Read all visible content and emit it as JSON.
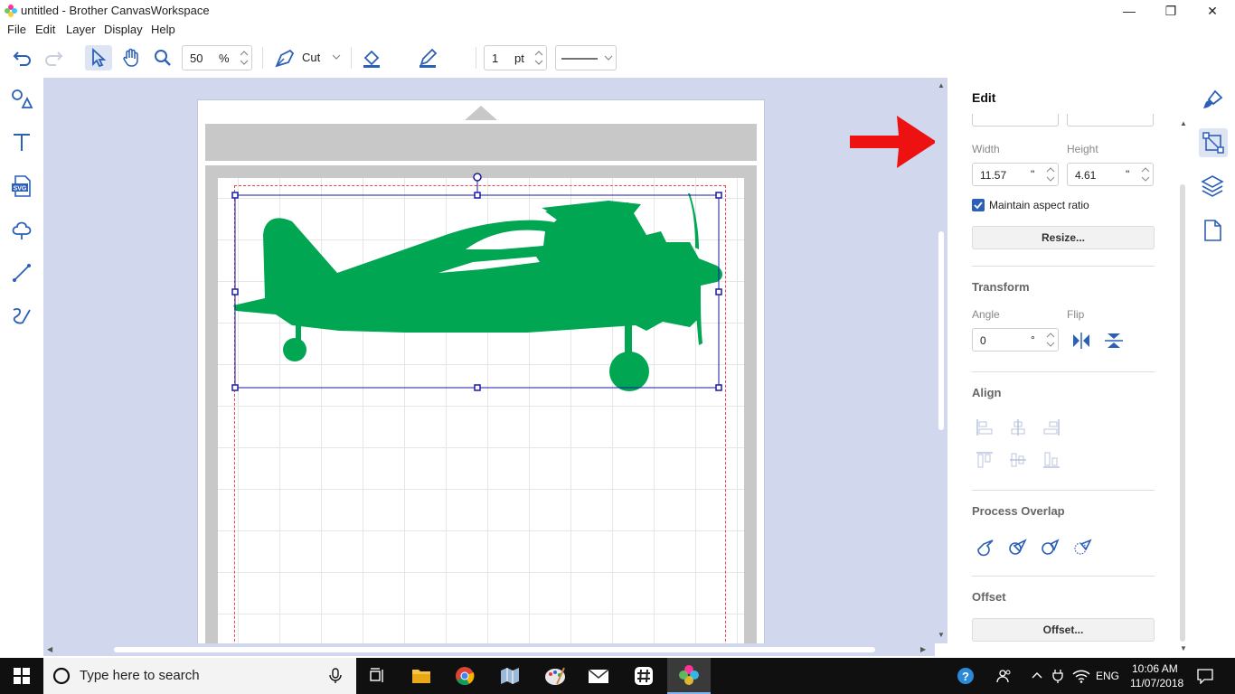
{
  "window": {
    "title": "untitled - Brother CanvasWorkspace",
    "minimize": "—",
    "restore": "❐",
    "close": "✕"
  },
  "menu": [
    "File",
    "Edit",
    "Layer",
    "Display",
    "Help"
  ],
  "toolbar": {
    "zoom_value": "50",
    "zoom_unit": "%",
    "mode": "Cut",
    "fill_color": "#00a651",
    "line_color": "#000000",
    "line_width_value": "1",
    "line_width_unit": "pt"
  },
  "left_tools": [
    "shapes-tool",
    "text-tool",
    "svg-import-tool",
    "outline-tool",
    "line-tool",
    "freehand-tool"
  ],
  "panel": {
    "title": "Edit",
    "width_label": "Width",
    "height_label": "Height",
    "width_value": "11.57",
    "height_value": "4.61",
    "inch_unit": "\"",
    "aspect_label": "Maintain aspect ratio",
    "aspect_checked": true,
    "resize_button": "Resize...",
    "transform_title": "Transform",
    "angle_label": "Angle",
    "flip_label": "Flip",
    "angle_value": "0",
    "angle_unit": "°",
    "align_title": "Align",
    "process_title": "Process Overlap",
    "offset_title": "Offset",
    "offset_button": "Offset..."
  },
  "canvas": {
    "shape_color": "#00a651",
    "selection_color": "#1a1aa6",
    "arrow_color": "#ee1111"
  },
  "taskbar": {
    "search_placeholder": "Type here to search",
    "language": "ENG",
    "time": "10:06 AM",
    "date": "11/07/2018"
  }
}
